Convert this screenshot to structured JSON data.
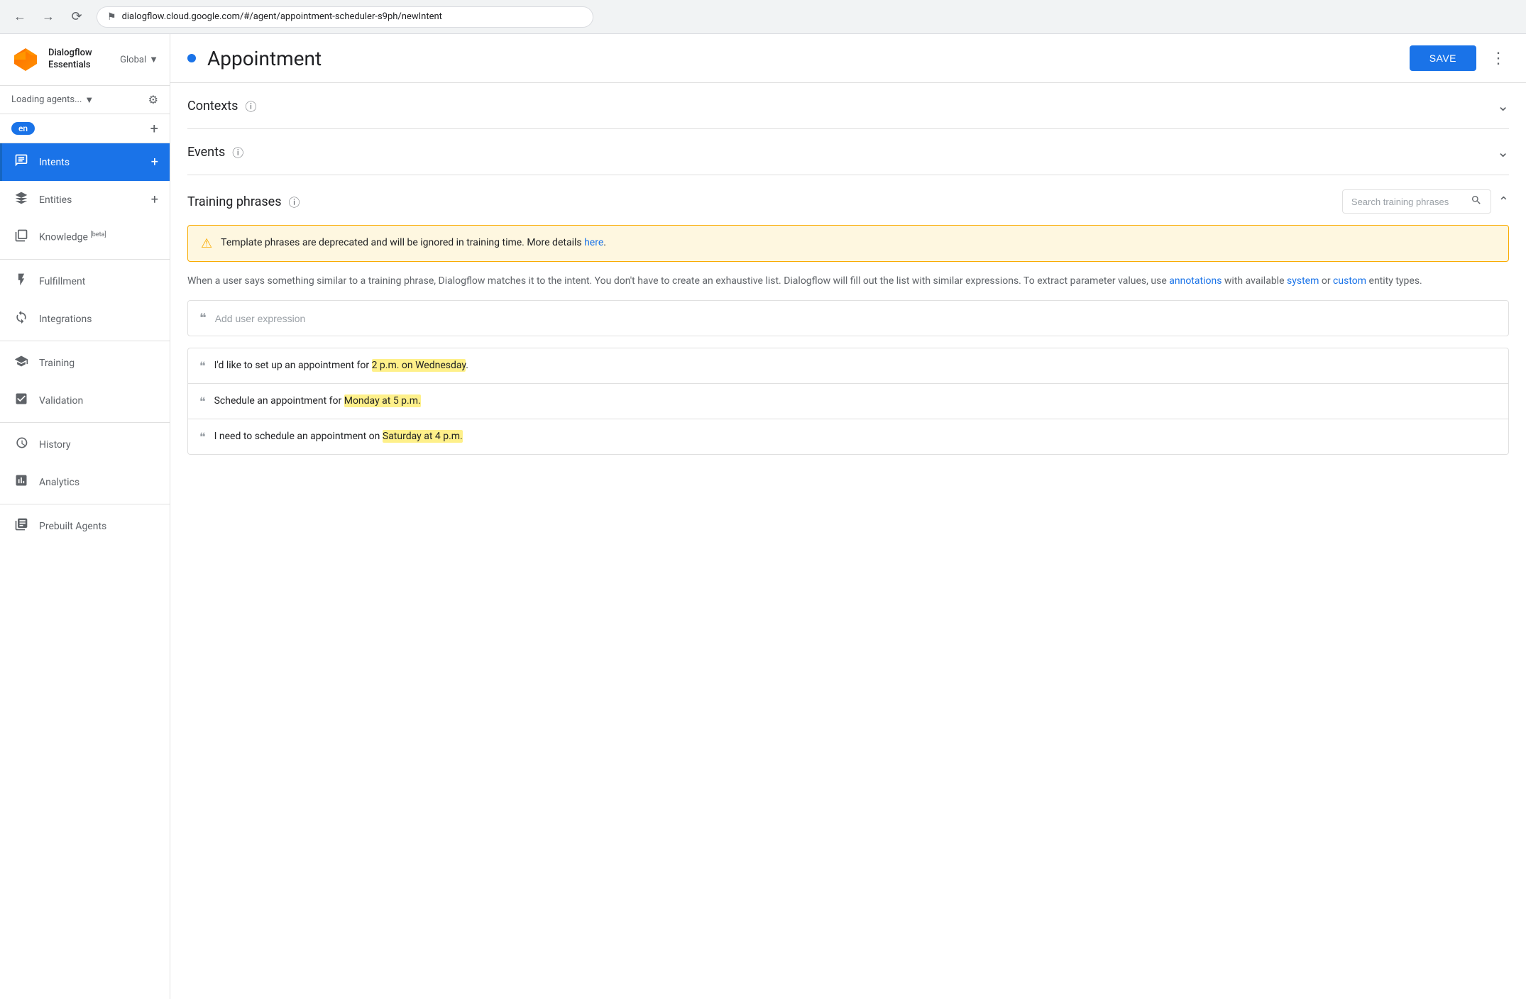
{
  "browser": {
    "url": "dialogflow.cloud.google.com/#/agent/appointment-scheduler-s9ph/newIntent",
    "back_tooltip": "Back",
    "forward_tooltip": "Forward",
    "reload_tooltip": "Reload"
  },
  "sidebar": {
    "logo_text_line1": "Dialogflow",
    "logo_text_line2": "Essentials",
    "global_label": "Global",
    "agent_placeholder": "Loading agents...",
    "language_badge": "en",
    "nav_items": [
      {
        "id": "intents",
        "label": "Intents",
        "icon": "💬",
        "active": true,
        "has_add": true
      },
      {
        "id": "entities",
        "label": "Entities",
        "icon": "🔗",
        "active": false,
        "has_add": true
      },
      {
        "id": "knowledge",
        "label": "Knowledge",
        "icon": "📓",
        "active": false,
        "badge": "[beta]",
        "has_add": false
      },
      {
        "id": "fulfillment",
        "label": "Fulfillment",
        "icon": "⚡",
        "active": false,
        "has_add": false
      },
      {
        "id": "integrations",
        "label": "Integrations",
        "icon": "🔄",
        "active": false,
        "has_add": false
      },
      {
        "id": "training",
        "label": "Training",
        "icon": "🎓",
        "active": false,
        "has_add": false
      },
      {
        "id": "validation",
        "label": "Validation",
        "icon": "✅",
        "active": false,
        "has_add": false
      },
      {
        "id": "history",
        "label": "History",
        "icon": "🕐",
        "active": false,
        "has_add": false
      },
      {
        "id": "analytics",
        "label": "Analytics",
        "icon": "📊",
        "active": false,
        "has_add": false
      },
      {
        "id": "prebuilt",
        "label": "Prebuilt Agents",
        "icon": "📋",
        "active": false,
        "has_add": false
      }
    ]
  },
  "topbar": {
    "title": "Appointment",
    "save_label": "SAVE",
    "status_color": "#1a73e8"
  },
  "sections": {
    "contexts": {
      "title": "Contexts",
      "collapsed": true
    },
    "events": {
      "title": "Events",
      "collapsed": true
    }
  },
  "training_phrases": {
    "title": "Training phrases",
    "search_placeholder": "Search training phrases",
    "warning": {
      "text": "Template phrases are deprecated and will be ignored in training time. More details ",
      "link_text": "here",
      "link_url": "#"
    },
    "description": "When a user says something similar to a training phrase, Dialogflow matches it to the intent. You don't have to create an exhaustive list. Dialogflow will fill out the list with similar expressions. To extract parameter values, use ",
    "desc_link1_text": "annotations",
    "desc_link2_text": "system",
    "desc_link3_text": "custom",
    "desc_suffix": " with available ",
    "desc_entity_suffix": " or ",
    "desc_end": " entity types.",
    "add_placeholder": "Add user expression",
    "phrases": [
      {
        "text_before": "I'd like to set up an appointment for ",
        "highlight": "2 p.m. on Wednesday",
        "text_after": "."
      },
      {
        "text_before": "Schedule an appointment for ",
        "highlight": "Monday at 5 p.m.",
        "text_after": ""
      },
      {
        "text_before": "I need to schedule an appointment on ",
        "highlight": "Saturday at 4 p.m.",
        "text_after": ""
      }
    ]
  }
}
